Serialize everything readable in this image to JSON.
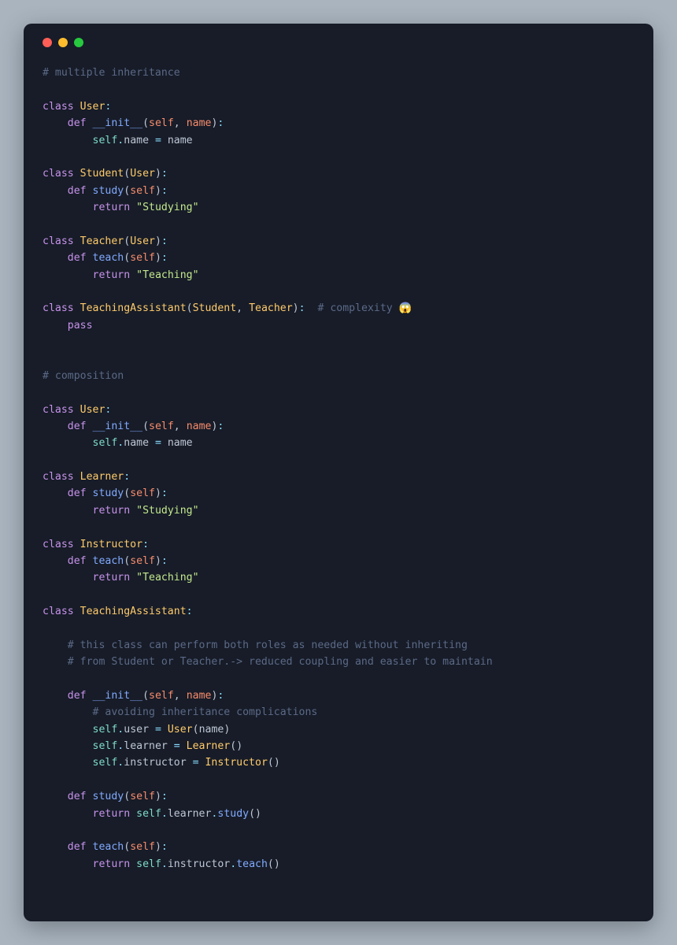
{
  "traffic": {
    "red": "#ff5f56",
    "yellow": "#ffbd2e",
    "green": "#27c93f"
  },
  "code": {
    "c1": "# multiple inheritance",
    "kw_class": "class",
    "kw_def": "def",
    "kw_return": "return",
    "kw_pass": "pass",
    "cls_User": "User",
    "cls_Student": "Student",
    "cls_Teacher": "Teacher",
    "cls_TeachingAssistant": "TeachingAssistant",
    "cls_Learner": "Learner",
    "cls_Instructor": "Instructor",
    "fn_init": "__init__",
    "fn_study": "study",
    "fn_teach": "teach",
    "prm_self": "self",
    "prm_name": "name",
    "attr_name": "name",
    "attr_user": "user",
    "attr_learner": "learner",
    "attr_instructor": "instructor",
    "str_study": "\"Studying\"",
    "str_teach": "\"Teaching\"",
    "lp": "(",
    "rp": ")",
    "colon": ":",
    "comma": ", ",
    "dot": ".",
    "eq": " = ",
    "c_complex": "# complexity 😱",
    "c2": "# composition",
    "c3": "# this class can perform both roles as needed without inheriting",
    "c4": "# from Student or Teacher.-> reduced coupling and easier to maintain",
    "c5": "# avoiding inheritance complications",
    "ind1": "    ",
    "ind2": "        "
  }
}
